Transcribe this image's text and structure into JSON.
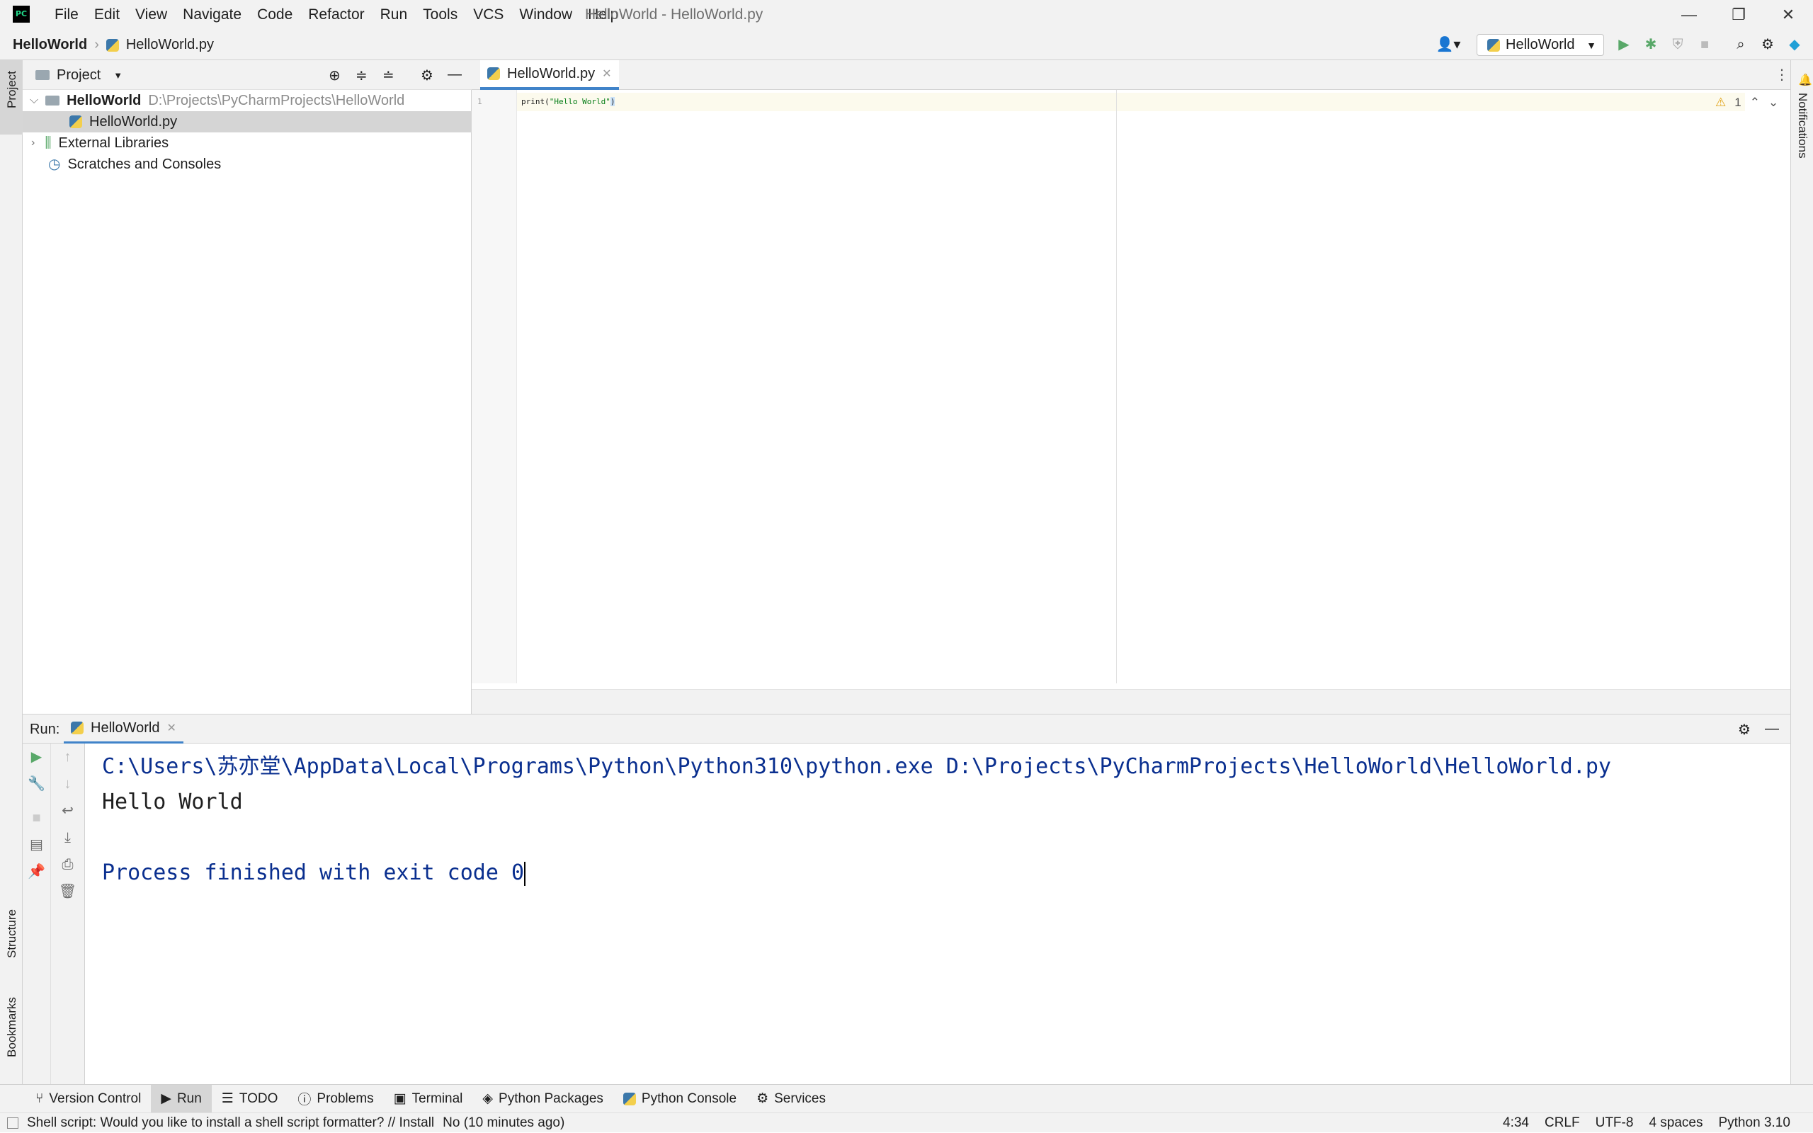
{
  "window": {
    "title": "HelloWorld - HelloWorld.py",
    "logo_text": "PC",
    "menu": [
      "File",
      "Edit",
      "View",
      "Navigate",
      "Code",
      "Refactor",
      "Run",
      "Tools",
      "VCS",
      "Window",
      "Help"
    ]
  },
  "navbar": {
    "project": "HelloWorld",
    "file": "HelloWorld.py",
    "run_config": "HelloWorld"
  },
  "side_tabs": {
    "project": "Project",
    "structure": "Structure",
    "bookmarks": "Bookmarks",
    "notifications": "Notifications"
  },
  "project_panel": {
    "title": "Project",
    "tree": [
      {
        "label": "HelloWorld",
        "path": "D:\\Projects\\PyCharmProjects\\HelloWorld"
      },
      {
        "label": "HelloWorld.py"
      },
      {
        "label": "External Libraries"
      },
      {
        "label": "Scratches and Consoles"
      }
    ]
  },
  "editor": {
    "tab": "HelloWorld.py",
    "line_number": "1",
    "code_fn": "print(",
    "code_str": "\"Hello World\"",
    "code_close": ")",
    "warning_count": "1"
  },
  "run_panel": {
    "label": "Run:",
    "tab": "HelloWorld",
    "output": [
      "C:\\Users\\苏亦堂\\AppData\\Local\\Programs\\Python\\Python310\\python.exe D:\\Projects\\PyCharmProjects\\HelloWorld\\HelloWorld.py",
      "Hello World",
      "",
      "Process finished with exit code 0"
    ]
  },
  "tool_windows": [
    "Version Control",
    "Run",
    "TODO",
    "Problems",
    "Terminal",
    "Python Packages",
    "Python Console",
    "Services"
  ],
  "status_bar": {
    "message": "Shell script: Would you like to install a shell script formatter? // Install",
    "message2": "No (10 minutes ago)",
    "position": "4:34",
    "line_ending": "CRLF",
    "encoding": "UTF-8",
    "indent": "4 spaces",
    "interpreter": "Python 3.10"
  },
  "colors": {
    "accent": "#4083c9",
    "run_green": "#59a869",
    "console_blue": "#0a2f8f"
  }
}
